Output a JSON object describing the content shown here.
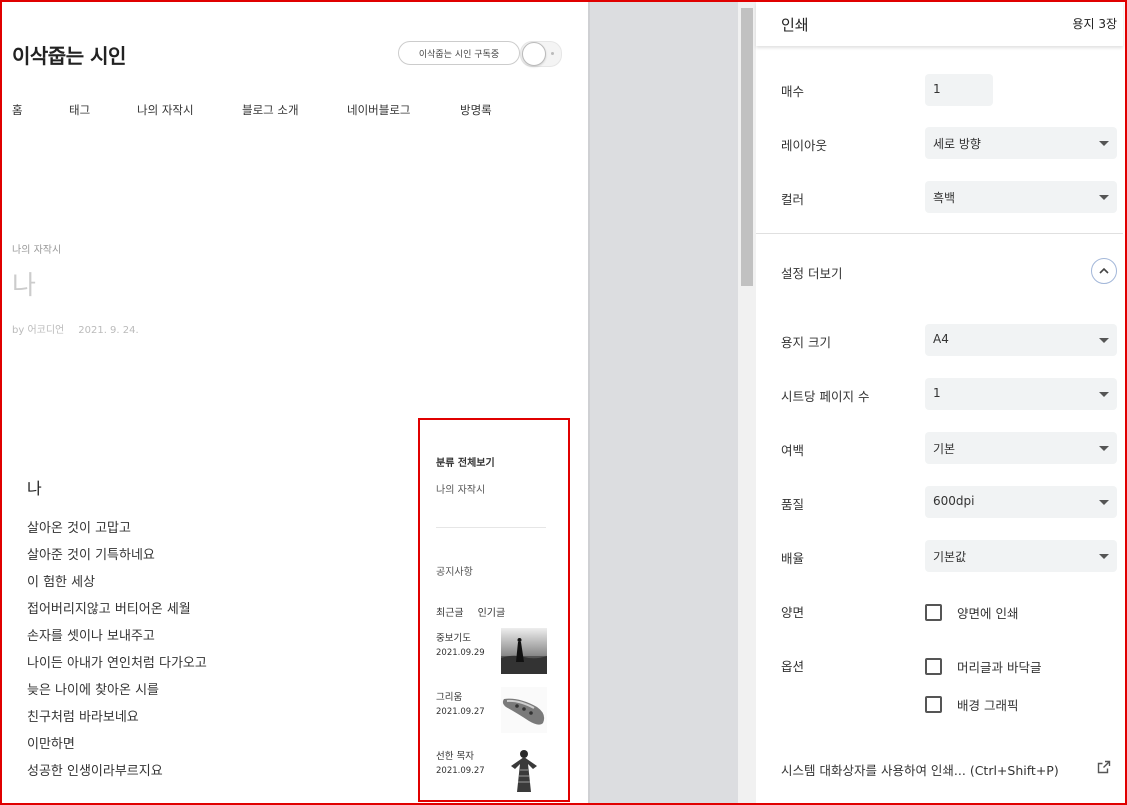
{
  "preview": {
    "blog_title": "이삭줍는 시인",
    "subscribe_label": "이삭줍는 시인 구독중",
    "nav": [
      "홈",
      "태그",
      "나의 자작시",
      "블로그 소개",
      "네이버블로그",
      "방명록"
    ],
    "post": {
      "category": "나의 자작시",
      "title": "나",
      "author": "by 어코디언",
      "date": "2021. 9. 24."
    },
    "poem_title": "나",
    "poem_lines": [
      "살아온 것이 고맙고",
      "살아준 것이 기특하네요",
      "이 험한 세상",
      "접어버리지않고 버티어온 세월",
      "손자를 셋이나 보내주고",
      "나이든 아내가 연인처럼 다가오고",
      "늦은 나이에 찾아온 시를",
      "친구처럼 바라보네요",
      "이만하면",
      "성공한 인생이라부르지요"
    ],
    "sidebar": {
      "heading": "분류 전체보기",
      "category": "나의 자작시",
      "notice": "공지사항",
      "tabs": [
        "최근글",
        "인기글"
      ],
      "posts": [
        {
          "title": "중보기도",
          "date": "2021.09.29",
          "thumb": "violinist-photo"
        },
        {
          "title": "그리움",
          "date": "2021.09.27",
          "thumb": "ocarina-photo"
        },
        {
          "title": "선한 목자",
          "date": "2021.09.27",
          "thumb": "shepherd-figure"
        }
      ]
    }
  },
  "print": {
    "title": "인쇄",
    "sheet_count": "용지 3장",
    "copies_label": "매수",
    "copies_value": "1",
    "layout_label": "레이아웃",
    "layout_value": "세로 방향",
    "color_label": "컬러",
    "color_value": "흑백",
    "more_settings_label": "설정 더보기",
    "paper_size_label": "용지 크기",
    "paper_size_value": "A4",
    "pages_per_sheet_label": "시트당 페이지 수",
    "pages_per_sheet_value": "1",
    "margins_label": "여백",
    "margins_value": "기본",
    "quality_label": "품질",
    "quality_value": "600dpi",
    "scale_label": "배율",
    "scale_value": "기본값",
    "duplex_label": "양면",
    "duplex_option": "양면에 인쇄",
    "options_label": "옵션",
    "headers_footers_option": "머리글과 바닥글",
    "background_graphics_option": "배경 그래픽",
    "system_dialog_link": "시스템 대화상자를 사용하여 인쇄... (Ctrl+Shift+P)"
  },
  "colors": {
    "highlight_border": "#e00000",
    "field_bg": "#f1f3f4",
    "expand_ring": "#a3b7d9"
  }
}
